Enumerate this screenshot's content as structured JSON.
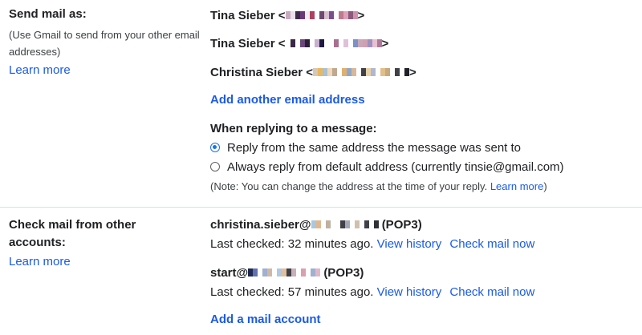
{
  "send_mail": {
    "title": "Send mail as:",
    "description": "(Use Gmail to send from your other email addresses)",
    "learn_more": "Learn more",
    "accounts": [
      {
        "name": "Tina Sieber <",
        "suffix": ">"
      },
      {
        "name": "Tina Sieber <",
        "suffix": ">"
      },
      {
        "name": "Christina Sieber <",
        "suffix": ">"
      }
    ],
    "add_address": "Add another email address",
    "reply_heading": "When replying to a message:",
    "reply_options": [
      {
        "label": "Reply from the same address the message was sent to",
        "selected": true
      },
      {
        "label": "Always reply from default address (currently tinsie@gmail.com)",
        "selected": false
      }
    ],
    "note_text": "(Note: You can change the address at the time of your reply.",
    "note_link": "Learn more",
    "note_close": ")"
  },
  "check_mail": {
    "title_line1": "Check mail from other",
    "title_line2": "accounts:",
    "learn_more": "Learn more",
    "accounts": [
      {
        "address_prefix": "christina.sieber@",
        "protocol": "(POP3)",
        "last_checked": "Last checked: 32 minutes ago.",
        "view_history": "View history",
        "check_now": "Check mail now"
      },
      {
        "address_prefix": "start@",
        "protocol": "(POP3)",
        "last_checked": "Last checked: 57 minutes ago.",
        "view_history": "View history",
        "check_now": "Check mail now"
      }
    ],
    "add_account": "Add a mail account"
  },
  "colors": {
    "link": "#1a5ae8",
    "radio_selected": "#1a73e8",
    "divider": "#dadce0"
  }
}
